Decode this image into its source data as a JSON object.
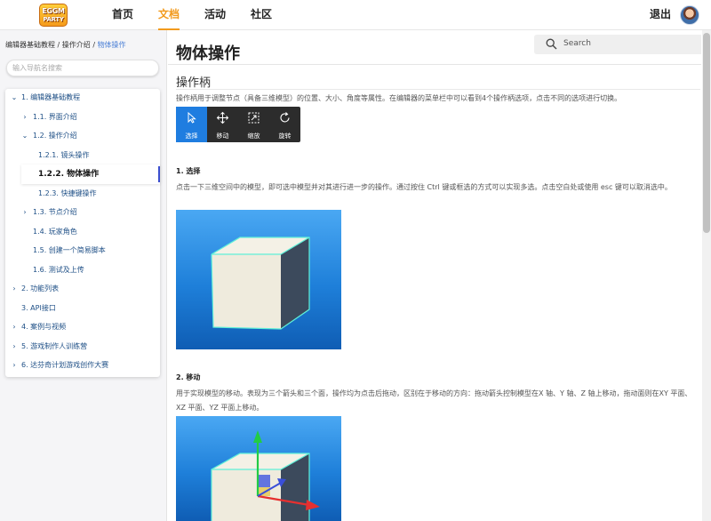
{
  "header": {
    "logo_line1": "EGGM",
    "logo_line2": "PARTY",
    "nav": [
      "首页",
      "文档",
      "活动",
      "社区"
    ],
    "active_nav": "文档",
    "logout": "退出"
  },
  "sidebar": {
    "breadcrumb": [
      "编辑器基础教程",
      "操作介绍",
      "物体操作"
    ],
    "breadcrumb_sep": " / ",
    "search_placeholder": "输入导航名搜索",
    "items": [
      {
        "label": "1. 编辑器基础教程",
        "expanded": true
      },
      {
        "label": "1.1. 界面介绍",
        "expanded": false
      },
      {
        "label": "1.2. 操作介绍",
        "expanded": true
      },
      {
        "label": "1.2.1. 镜头操作"
      },
      {
        "label": "1.2.2. 物体操作",
        "active": true
      },
      {
        "label": "1.2.3. 快捷键操作"
      },
      {
        "label": "1.3. 节点介绍",
        "expanded": false
      },
      {
        "label": "1.4. 玩家角色"
      },
      {
        "label": "1.5. 创建一个简易脚本"
      },
      {
        "label": "1.6. 测试及上传"
      },
      {
        "label": "2. 功能列表",
        "expanded": false
      },
      {
        "label": "3. API接口"
      },
      {
        "label": "4. 案例与视频",
        "expanded": false
      },
      {
        "label": "5. 游戏制作人训练营",
        "expanded": false
      },
      {
        "label": "6. 达芬奇计划游戏创作大赛",
        "expanded": false
      }
    ]
  },
  "main": {
    "title": "物体操作",
    "search_label": "Search",
    "section_title": "操作柄",
    "intro": "操作柄用于调整节点（具备三维模型）的位置、大小、角度等属性。在编辑器的菜单栏中可以看到4个操作柄选项，点击不同的选项进行切换。",
    "tools": [
      {
        "label": "选择",
        "icon": "cursor-icon",
        "active": true
      },
      {
        "label": "移动",
        "icon": "move-icon"
      },
      {
        "label": "缩放",
        "icon": "scale-icon"
      },
      {
        "label": "旋转",
        "icon": "rotate-icon"
      }
    ],
    "sec1_title": "1. 选择",
    "sec1_text": "点击一下三维空间中的模型，即可选中模型并对其进行进一步的操作。通过按住 Ctrl 键或框选的方式可以实现多选。点击空白处或使用 esc 键可以取消选中。",
    "sec2_title": "2. 移动",
    "sec2_text": "用于实现模型的移动。表现为三个箭头和三个面，操作均为点击后拖动，区别在于移动的方向：拖动箭头控制模型在X 轴、Y 轴、Z 轴上移动，拖动面则在XY 平面、XZ 平面、YZ 平面上移动。"
  },
  "colors": {
    "accent": "#f29a1d",
    "link": "#4a7fd6",
    "tool_active": "#1f7de0",
    "tree_text": "#1e4f86"
  }
}
